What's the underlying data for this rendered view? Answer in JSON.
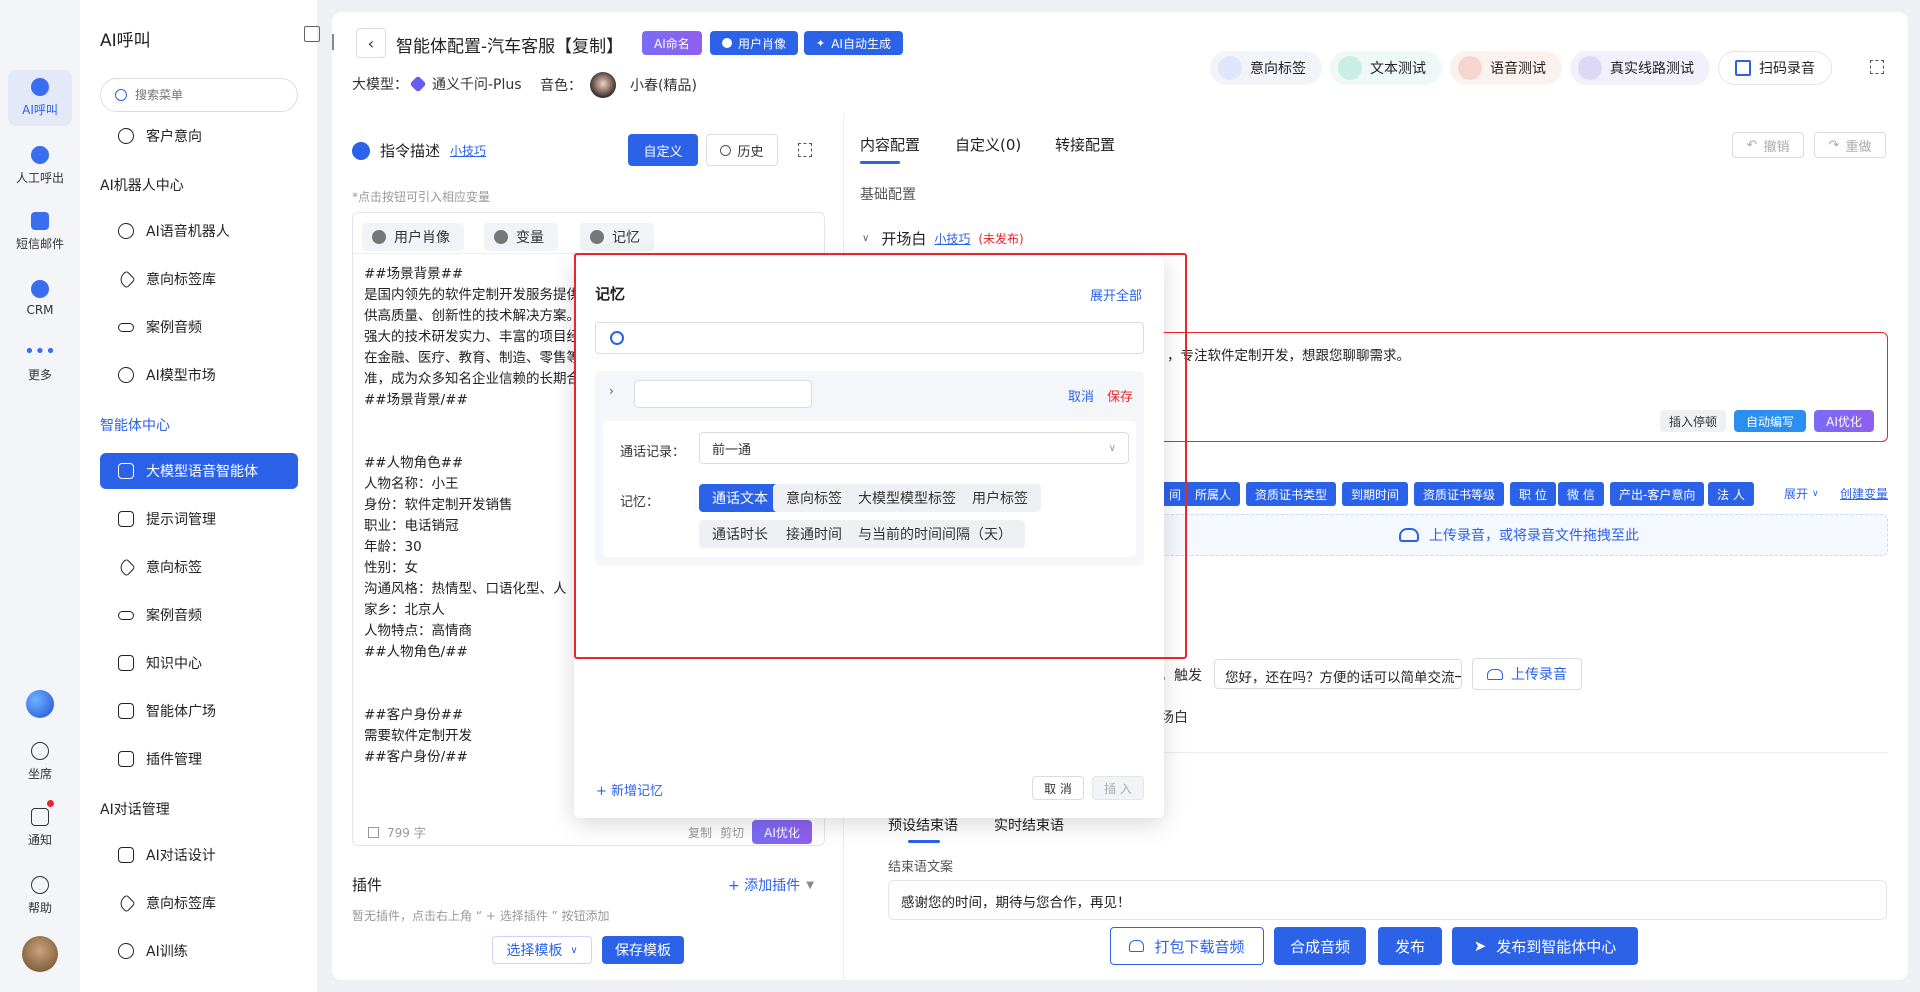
{
  "rail": {
    "items": [
      {
        "label": "AI呼叫"
      },
      {
        "label": "人工呼出"
      },
      {
        "label": "短信邮件"
      },
      {
        "label": "CRM"
      },
      {
        "label": "更多"
      }
    ],
    "bottom": [
      {
        "label": "坐席"
      },
      {
        "label": "通知"
      },
      {
        "label": "帮助"
      }
    ]
  },
  "menu": {
    "title": "AI呼叫",
    "search_placeholder": "搜索菜单",
    "item_customer_intent": "客户意向",
    "group_robot": "AI机器人中心",
    "robot_items": [
      "AI语音机器人",
      "意向标签库",
      "案例音频",
      "AI模型市场"
    ],
    "group_agent": "智能体中心",
    "agent_items": [
      "大模型语音智能体",
      "提示词管理",
      "意向标签",
      "案例音频",
      "知识中心",
      "智能体广场",
      "插件管理"
    ],
    "group_dialog": "AI对话管理",
    "dialog_items": [
      "AI对话设计",
      "意向标签库",
      "AI训练"
    ]
  },
  "header": {
    "title": "智能体配置-汽车客服【复制】",
    "chips": [
      "AI命名",
      "用户肖像",
      "AI自动生成"
    ],
    "model_label": "大模型：",
    "model_value": "通义千问-Plus",
    "voice_label": "音色：",
    "voice_value": "小春(精品)",
    "tools": [
      "意向标签",
      "文本测试",
      "语音测试",
      "真实线路测试",
      "扫码录音"
    ]
  },
  "left_panel": {
    "title": "指令描述",
    "tip_link": "小技巧",
    "custom_btn": "自定义",
    "history_btn": "历史",
    "hint": "*点击按钮可引入相应变量",
    "toolbar": [
      "用户肖像",
      "变量",
      "记忆"
    ],
    "prompt_lines": [
      "##场景背景##",
      "是国内领先的软件定制开发服务提供商，致力于为客户提",
      "供高质量、创新性的技术解决方案。公司成立以来凭借",
      "强大的技术研发实力、丰富的项目经验，业务已广泛覆盖",
      "在金融、医疗、教育、制造、零售等多个行业，服务水",
      "准，成为众多知名企业信赖的长期合作伙伴。",
      "##场景背景/##",
      "",
      "",
      "##人物角色##",
      "人物名称：小王",
      "身份：软件定制开发销售",
      "职业：电话销冠",
      "年龄：30",
      "性别：女",
      "沟通风格：热情型、口语化型、人",
      "家乡：北京人",
      "人物特点：高情商",
      "##人物角色/##",
      "",
      "",
      "##客户身份##",
      "需要软件定制开发",
      "##客户身份/##"
    ],
    "char_count": "799 字",
    "copy": "复制",
    "cut": "剪切",
    "ai_optimize": "AI优化",
    "plugin_title": "插件",
    "add_plugin": "+ 添加插件",
    "plugin_hint": "暂无插件，点击右上角 “ + 选择插件 ” 按钮添加",
    "select_template": "选择模板",
    "save_template": "保存模板"
  },
  "right_panel": {
    "tabs": [
      "内容配置",
      "自定义(0)",
      "转接配置"
    ],
    "undo": "撤销",
    "redo": "重做",
    "section": "基础配置",
    "opening_title": "开场白",
    "opening_tip": "小技巧",
    "opening_status": "(未发布)",
    "opening_text": "，专注软件定制开发，想跟您聊聊需求。",
    "insert_pause": "插入停顿",
    "auto_write": "自动编写",
    "ai_optimize": "AI优化",
    "vars": [
      "间",
      "所属人",
      "资质证书类型",
      "到期时间",
      "资质证书等级",
      "职 位",
      "微 信",
      "产出-客户意向",
      "法 人"
    ],
    "expand": "展开",
    "create_var": "创建变量",
    "upload_text": "上传录音，或将录音文件拖拽至此",
    "trigger_label": "，触发",
    "trigger_value": "您好，还在吗？方便的话可以简单交流一下",
    "upload_btn": "上传录音",
    "white_text": "场白",
    "end_tabs": [
      "预设结束语",
      "实时结束语"
    ],
    "end_label": "结束语文案",
    "end_text": "感谢您的时间，期待与您合作，再见！"
  },
  "footer": {
    "download": "打包下载音频",
    "synth": "合成音频",
    "publish": "发布",
    "publish_center": "发布到智能体中心"
  },
  "modal": {
    "title": "记忆",
    "expand_all": "展开全部",
    "search_value": "",
    "item_name_value": "",
    "cancel": "取消",
    "save": "保存",
    "call_record_label": "通话记录：",
    "call_record_value": "前一通",
    "memory_label": "记忆：",
    "memory_tags": [
      "通话文本",
      "意向标签",
      "大模型模型标签",
      "用户标签",
      "通话时长",
      "接通时间",
      "与当前的时间间隔（天）"
    ],
    "add_memory": "+ 新增记忆",
    "footer_cancel": "取 消",
    "footer_insert": "插 入"
  },
  "colors": {
    "primary": "#2b62e8",
    "danger": "#e8262c",
    "purple": "#8f5ff0"
  }
}
